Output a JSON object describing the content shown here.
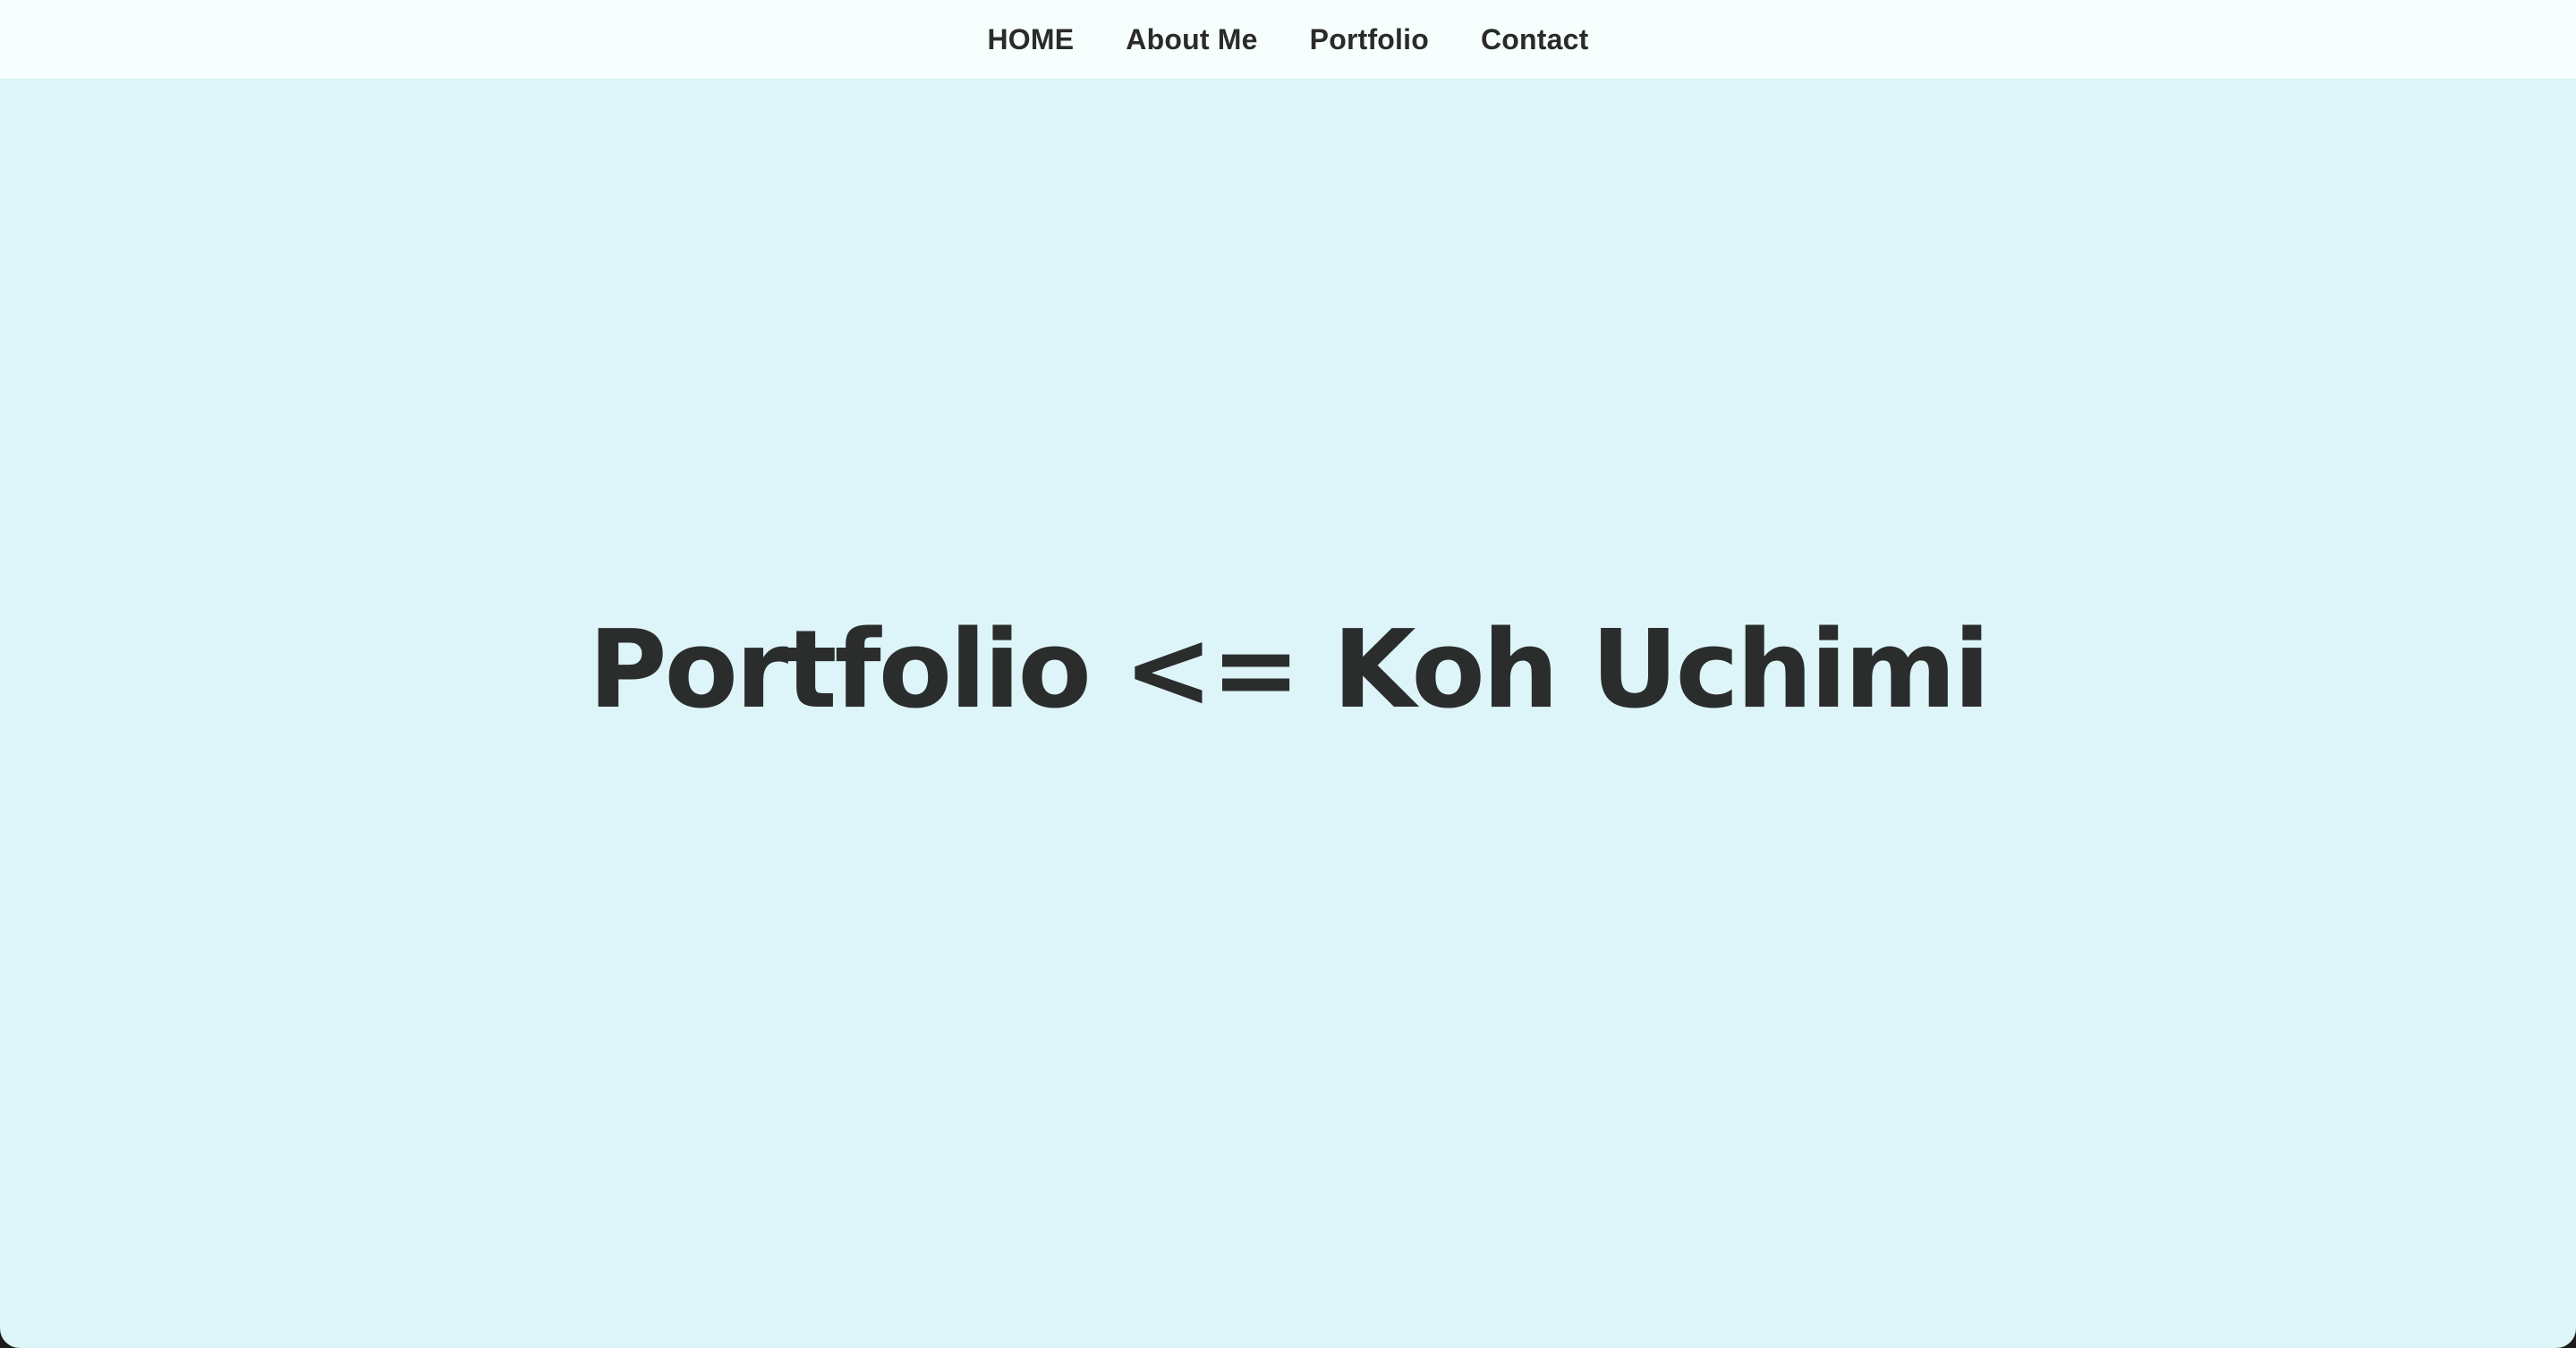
{
  "nav": {
    "items": [
      {
        "label": "HOME"
      },
      {
        "label": "About Me"
      },
      {
        "label": "Portfolio"
      },
      {
        "label": "Contact"
      }
    ]
  },
  "hero": {
    "title": "Portfolio <= Koh Uchimi"
  },
  "colors": {
    "background": "#ddf5f8",
    "navbar": "#f7fefe",
    "text": "#2b2d2d"
  }
}
